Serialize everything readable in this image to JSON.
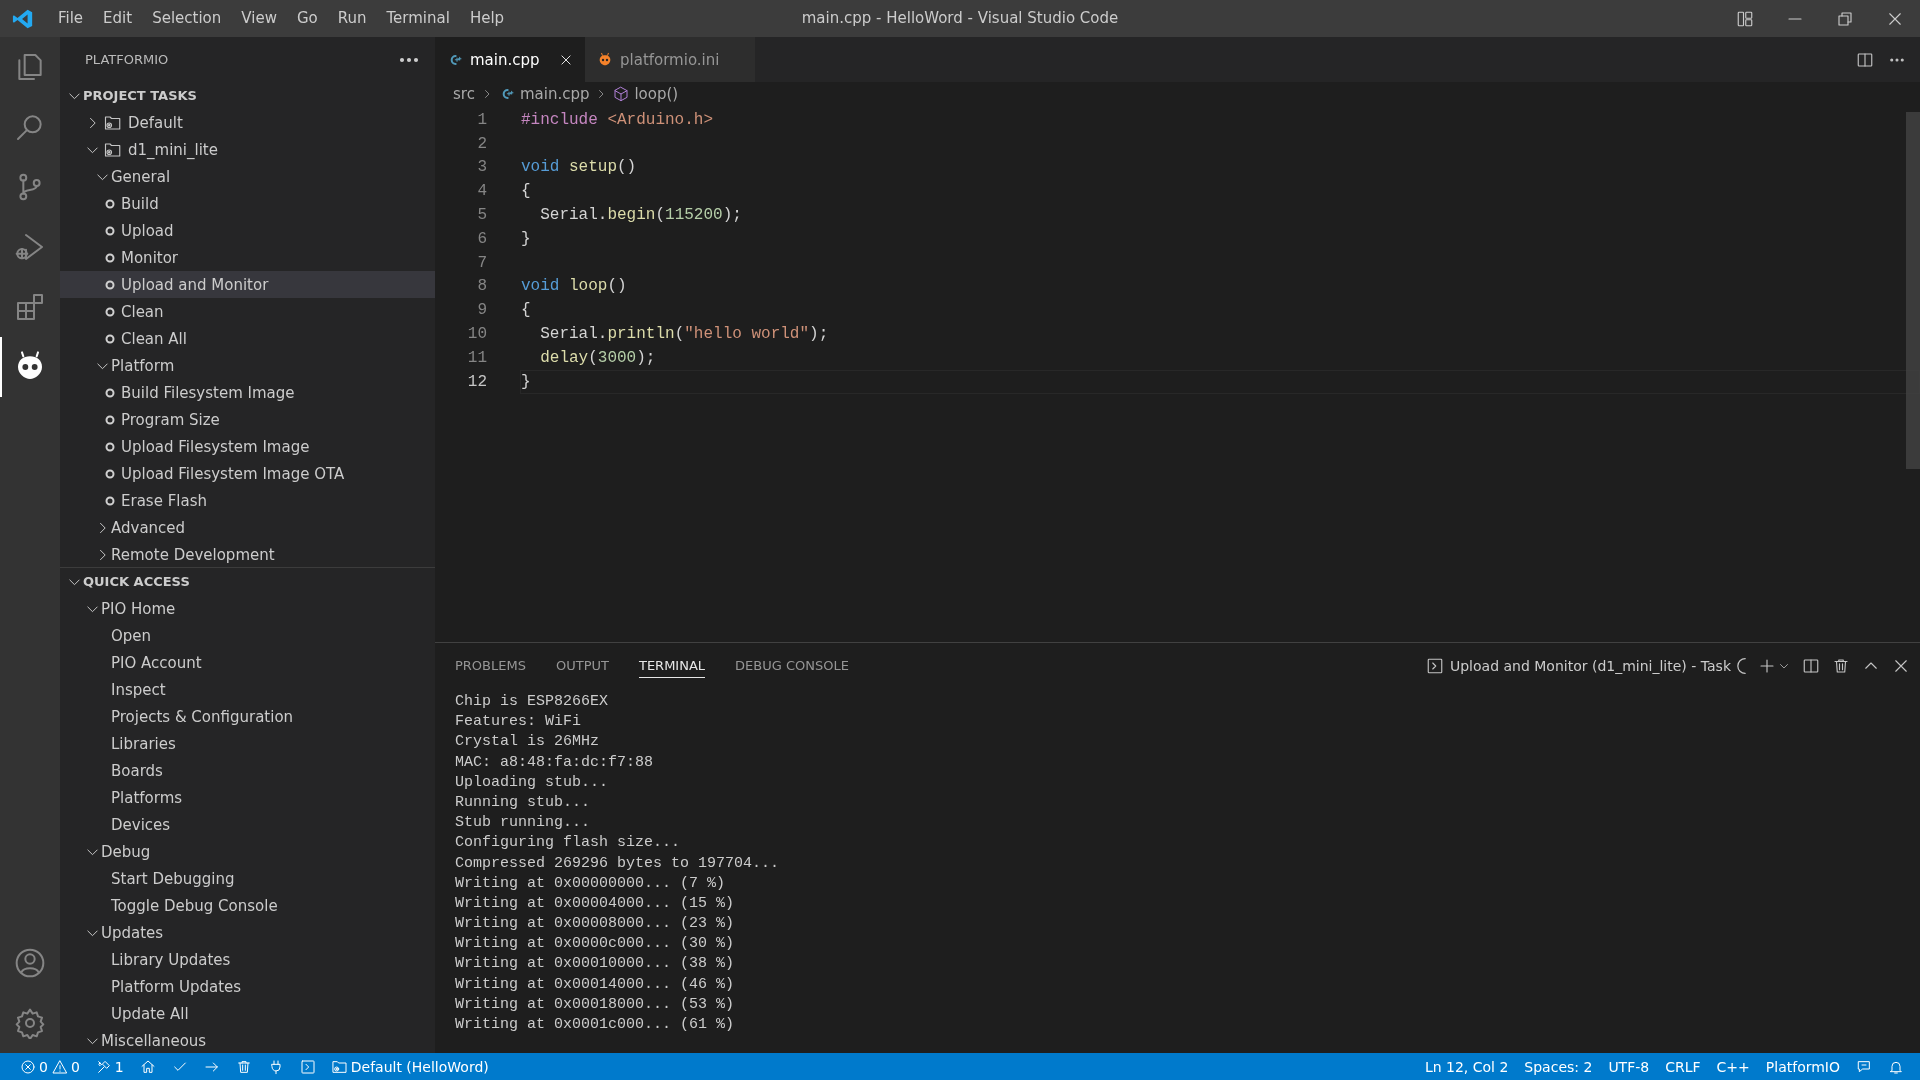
{
  "window": {
    "title": "main.cpp - HelloWord - Visual Studio Code"
  },
  "menu": [
    "File",
    "Edit",
    "Selection",
    "View",
    "Go",
    "Run",
    "Terminal",
    "Help"
  ],
  "activity_bar": {
    "top": [
      {
        "kind": "explorer",
        "selected": false
      },
      {
        "kind": "search",
        "selected": false
      },
      {
        "kind": "source_control",
        "selected": false
      },
      {
        "kind": "run_debug",
        "selected": false
      },
      {
        "kind": "extensions",
        "selected": false
      },
      {
        "kind": "platformio",
        "selected": true
      }
    ],
    "bottom": [
      {
        "kind": "account"
      },
      {
        "kind": "settings"
      }
    ]
  },
  "sidebar": {
    "title": "PLATFORMIO",
    "sections": [
      {
        "title": "PROJECT TASKS",
        "expanded": true,
        "items": [
          {
            "label": "Default",
            "kind": "env",
            "expanded": false,
            "selected": false
          },
          {
            "label": "d1_mini_lite",
            "kind": "env",
            "expanded": true,
            "selected": false,
            "children": [
              {
                "label": "General",
                "kind": "group",
                "expanded": true,
                "selected": false,
                "children": [
                  {
                    "label": "Build",
                    "kind": "task",
                    "selected": false
                  },
                  {
                    "label": "Upload",
                    "kind": "task",
                    "selected": false
                  },
                  {
                    "label": "Monitor",
                    "kind": "task",
                    "selected": false
                  },
                  {
                    "label": "Upload and Monitor",
                    "kind": "task",
                    "selected": true
                  },
                  {
                    "label": "Clean",
                    "kind": "task",
                    "selected": false
                  },
                  {
                    "label": "Clean All",
                    "kind": "task",
                    "selected": false
                  }
                ]
              },
              {
                "label": "Platform",
                "kind": "group",
                "expanded": true,
                "selected": false,
                "children": [
                  {
                    "label": "Build Filesystem Image",
                    "kind": "task",
                    "selected": false
                  },
                  {
                    "label": "Program Size",
                    "kind": "task",
                    "selected": false
                  },
                  {
                    "label": "Upload Filesystem Image",
                    "kind": "task",
                    "selected": false
                  },
                  {
                    "label": "Upload Filesystem Image OTA",
                    "kind": "task",
                    "selected": false
                  },
                  {
                    "label": "Erase Flash",
                    "kind": "task",
                    "selected": false
                  }
                ]
              },
              {
                "label": "Advanced",
                "kind": "group",
                "expanded": false,
                "selected": false
              },
              {
                "label": "Remote Development",
                "kind": "group",
                "expanded": false,
                "selected": false
              }
            ]
          }
        ]
      },
      {
        "title": "QUICK ACCESS",
        "expanded": true,
        "items": [
          {
            "label": "PIO Home",
            "kind": "group",
            "expanded": true,
            "selected": false,
            "children": [
              {
                "label": "Open",
                "kind": "link",
                "selected": false
              },
              {
                "label": "PIO Account",
                "kind": "link",
                "selected": false
              },
              {
                "label": "Inspect",
                "kind": "link",
                "selected": false
              },
              {
                "label": "Projects & Configuration",
                "kind": "link",
                "selected": false
              },
              {
                "label": "Libraries",
                "kind": "link",
                "selected": false
              },
              {
                "label": "Boards",
                "kind": "link",
                "selected": false
              },
              {
                "label": "Platforms",
                "kind": "link",
                "selected": false
              },
              {
                "label": "Devices",
                "kind": "link",
                "selected": false
              }
            ]
          },
          {
            "label": "Debug",
            "kind": "group",
            "expanded": true,
            "selected": false,
            "children": [
              {
                "label": "Start Debugging",
                "kind": "link",
                "selected": false
              },
              {
                "label": "Toggle Debug Console",
                "kind": "link",
                "selected": false
              }
            ]
          },
          {
            "label": "Updates",
            "kind": "group",
            "expanded": true,
            "selected": false,
            "children": [
              {
                "label": "Library Updates",
                "kind": "link",
                "selected": false
              },
              {
                "label": "Platform Updates",
                "kind": "link",
                "selected": false
              },
              {
                "label": "Update All",
                "kind": "link",
                "selected": false
              }
            ]
          },
          {
            "label": "Miscellaneous",
            "kind": "group",
            "expanded": true,
            "selected": false
          }
        ]
      }
    ]
  },
  "editor": {
    "tabs": [
      {
        "label": "main.cpp",
        "kind": "cpp",
        "selected": true
      },
      {
        "label": "platformio.ini",
        "kind": "platformio",
        "selected": false
      }
    ],
    "breadcrumb": [
      {
        "label": "src",
        "kind": "folder"
      },
      {
        "label": "main.cpp",
        "kind": "cpp"
      },
      {
        "label": "loop()",
        "kind": "method"
      }
    ],
    "lines": [
      {
        "number": "1",
        "current": false,
        "indented": false,
        "tokens": [
          {
            "kind": "preproc",
            "text": "#include"
          },
          {
            "kind": "string",
            "text": "<Arduino.h>",
            "space_before": true
          }
        ]
      },
      {
        "number": "2",
        "current": false
      },
      {
        "number": "3",
        "current": false,
        "indented": false,
        "tokens": [
          {
            "kind": "keyword",
            "text": "void"
          },
          {
            "kind": "function",
            "text": "setup",
            "space_before": true
          },
          {
            "kind": "plain",
            "text": "()"
          }
        ]
      },
      {
        "number": "4",
        "current": false,
        "indented": false,
        "tokens": [
          {
            "kind": "plain",
            "text": "{"
          }
        ]
      },
      {
        "number": "5",
        "current": false,
        "indented": true,
        "tokens": [
          {
            "kind": "plain",
            "text": "Serial."
          },
          {
            "kind": "function",
            "text": "begin"
          },
          {
            "kind": "plain",
            "text": "("
          },
          {
            "kind": "number",
            "text": "115200"
          },
          {
            "kind": "plain",
            "text": ");"
          }
        ]
      },
      {
        "number": "6",
        "current": false,
        "indented": false,
        "tokens": [
          {
            "kind": "plain",
            "text": "}"
          }
        ]
      },
      {
        "number": "7",
        "current": false
      },
      {
        "number": "8",
        "current": false,
        "indented": false,
        "tokens": [
          {
            "kind": "keyword",
            "text": "void"
          },
          {
            "kind": "function",
            "text": "loop",
            "space_before": true
          },
          {
            "kind": "plain",
            "text": "()"
          }
        ]
      },
      {
        "number": "9",
        "current": false,
        "indented": false,
        "tokens": [
          {
            "kind": "plain",
            "text": "{"
          }
        ]
      },
      {
        "number": "10",
        "current": false,
        "indented": true,
        "tokens": [
          {
            "kind": "plain",
            "text": "Serial."
          },
          {
            "kind": "function",
            "text": "println"
          },
          {
            "kind": "plain",
            "text": "("
          },
          {
            "kind": "string",
            "text": "\"hello world\""
          },
          {
            "kind": "plain",
            "text": ");"
          }
        ]
      },
      {
        "number": "11",
        "current": false,
        "indented": true,
        "tokens": [
          {
            "kind": "function",
            "text": "delay"
          },
          {
            "kind": "plain",
            "text": "("
          },
          {
            "kind": "number",
            "text": "3000"
          },
          {
            "kind": "plain",
            "text": ");"
          }
        ]
      },
      {
        "number": "12",
        "current": true,
        "indented": false,
        "tokens": [
          {
            "kind": "plain",
            "text": "}"
          }
        ]
      }
    ]
  },
  "panel": {
    "tabs": [
      {
        "label": "PROBLEMS",
        "selected": false
      },
      {
        "label": "OUTPUT",
        "selected": false
      },
      {
        "label": "TERMINAL",
        "selected": true
      },
      {
        "label": "DEBUG CONSOLE",
        "selected": false
      }
    ],
    "terminal_name": "Upload and Monitor (d1_mini_lite) - Task",
    "terminal_lines": [
      "Chip is ESP8266EX",
      "Features: WiFi",
      "Crystal is 26MHz",
      "MAC: a8:48:fa:dc:f7:88",
      "Uploading stub...",
      "Running stub...",
      "Stub running...",
      "Configuring flash size...",
      "Compressed 269296 bytes to 197704...",
      "Writing at 0x00000000... (7 %)",
      "Writing at 0x00004000... (15 %)",
      "Writing at 0x00008000... (23 %)",
      "Writing at 0x0000c000... (30 %)",
      "Writing at 0x00010000... (38 %)",
      "Writing at 0x00014000... (46 %)",
      "Writing at 0x00018000... (53 %)",
      "Writing at 0x0001c000... (61 %)"
    ]
  },
  "status_bar": {
    "left": [
      {
        "kind": "errors",
        "text": "0"
      },
      {
        "kind": "warnings",
        "text": "0"
      },
      {
        "kind": "tools",
        "text": "1"
      },
      {
        "kind": "home"
      },
      {
        "kind": "check"
      },
      {
        "kind": "arrow"
      },
      {
        "kind": "trash"
      },
      {
        "kind": "plug"
      },
      {
        "kind": "terminal"
      },
      {
        "kind": "env",
        "text": "Default (HelloWord)"
      }
    ],
    "right": [
      {
        "kind": "text",
        "text": "Ln 12, Col 2"
      },
      {
        "kind": "text",
        "text": "Spaces: 2"
      },
      {
        "kind": "text",
        "text": "UTF-8"
      },
      {
        "kind": "text",
        "text": "CRLF"
      },
      {
        "kind": "text",
        "text": "C++"
      },
      {
        "kind": "text",
        "text": "PlatformIO"
      },
      {
        "kind": "feedback"
      },
      {
        "kind": "bell"
      }
    ]
  }
}
